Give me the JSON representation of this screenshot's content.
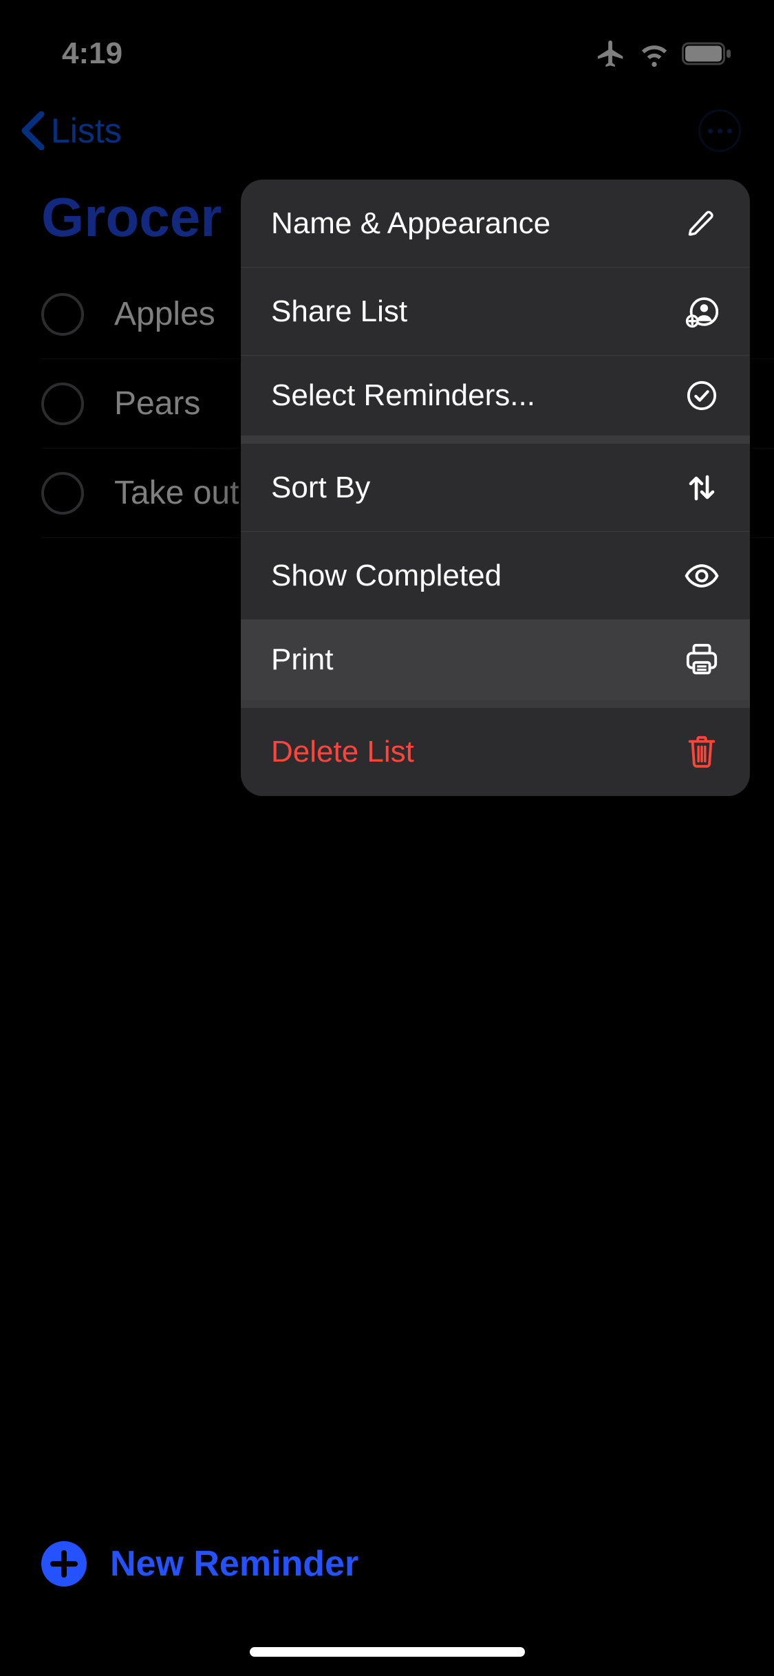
{
  "status": {
    "time": "4:19"
  },
  "nav": {
    "back_label": "Lists"
  },
  "list": {
    "title": "Grocer",
    "items": [
      {
        "label": "Apples"
      },
      {
        "label": "Pears"
      },
      {
        "label": "Take out"
      }
    ]
  },
  "menu": {
    "items": [
      {
        "label": "Name & Appearance",
        "icon": "pencil-icon"
      },
      {
        "label": "Share List",
        "icon": "share-person-icon"
      },
      {
        "label": "Select Reminders...",
        "icon": "checkmark-circle-icon"
      },
      {
        "label": "Sort By",
        "icon": "arrows-up-down-icon"
      },
      {
        "label": "Show Completed",
        "icon": "eye-icon"
      },
      {
        "label": "Print",
        "icon": "printer-icon"
      },
      {
        "label": "Delete List",
        "icon": "trash-icon"
      }
    ]
  },
  "bottom": {
    "new_reminder_label": "New Reminder"
  }
}
